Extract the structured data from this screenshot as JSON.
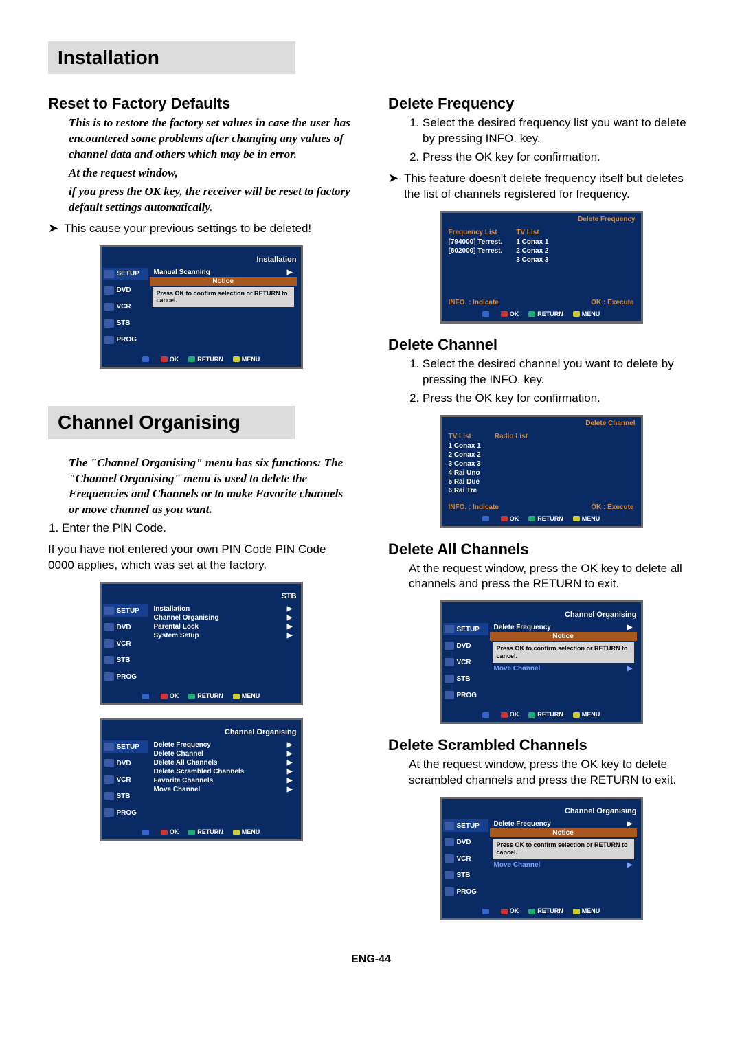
{
  "sections": {
    "installation": "Installation",
    "channel_org": "Channel Organising"
  },
  "left": {
    "reset_head": "Reset to Factory Defaults",
    "reset_italic_1": "This is to restore the factory set values in case the user has encountered some problems  after changing any values of channel data and others which may be in error.",
    "reset_italic_2": "At the request window,",
    "reset_italic_3": "if you press the OK key, the receiver will be reset to factory default settings automatically.",
    "reset_note": "This cause your previous settings to be deleted!",
    "chorg_italic": "The \"Channel Organising\" menu has six functions: The \"Channel Organising\" menu is used to delete the Frequencies and Channels or to make Favorite channels or move channel as you want.",
    "pin_step": "Enter the PIN Code.",
    "pin_note": "If you have not entered your own PIN Code PIN Code 0000 applies, which was set at the factory."
  },
  "right": {
    "delfreq_head": "Delete Frequency",
    "delfreq_s1": "Select the desired frequency list you want to delete by pressing INFO. key.",
    "delfreq_s2": "Press the OK key for confirmation.",
    "delfreq_note": "This feature doesn't delete frequency itself but deletes the list of channels registered for frequency.",
    "delch_head": "Delete Channel",
    "delch_s1": "Select the desired channel you want to delete by pressing the INFO. key.",
    "delch_s2": "Press the OK key for confirmation.",
    "delall_head": "Delete All Channels",
    "delall_text": "At the request window, press the OK key to delete all channels and press the RETURN to exit.",
    "delscr_head": "Delete Scrambled Channels",
    "delscr_text": "At the request window, press the OK key to delete scrambled channels and press the RETURN to exit."
  },
  "foot": "ENG-44",
  "side_labels": {
    "setup": "SETUP",
    "dvd": "DVD",
    "vcr": "VCR",
    "stb": "STB",
    "prog": "PROG"
  },
  "osd_foot": {
    "ok": "OK",
    "return": "RETURN",
    "menu": "MENU"
  },
  "shot_install": {
    "title": "Installation",
    "line1": "Manual Scanning",
    "notice": "Notice",
    "notice_body": "Press OK to confirm selection or RETURN to cancel."
  },
  "shot_stb": {
    "title": "STB",
    "l1": "Installation",
    "l2": "Channel Organising",
    "l3": "Parental Lock",
    "l4": "System Setup"
  },
  "shot_chorg": {
    "title": "Channel Organising",
    "l1": "Delete Frequency",
    "l2": "Delete Channel",
    "l3": "Delete All Channels",
    "l4": "Delete Scrambled Channels",
    "l5": "Favorite Channels",
    "l6": "Move Channel"
  },
  "shot_delfreq": {
    "title": "Delete Frequency",
    "left_head": "Frequency List",
    "left_1": "[794000] Terrest.",
    "left_2": "[802000] Terrest.",
    "right_head": "TV List",
    "right_1": "1 Conax 1",
    "right_2": "2 Conax 2",
    "right_3": "3 Conax 3",
    "b1": "INFO. : Indicate",
    "b2": "OK : Execute"
  },
  "shot_delch": {
    "title": "Delete Channel",
    "left_head": "TV List",
    "l1": "1 Conax 1",
    "l2": "2 Conax 2",
    "l3": "3 Conax 3",
    "l4": "4 Rai Uno",
    "l5": "5 Rai Due",
    "l6": "6 Rai Tre",
    "right_head": "Radio List",
    "b1": "INFO. : Indicate",
    "b2": "OK : Execute"
  },
  "shot_notice_generic": {
    "title": "Channel Organising",
    "l1": "Delete Frequency",
    "notice": "Notice",
    "notice_body": "Press OK to confirm selection or RETURN to cancel.",
    "l_after": "Move Channel"
  }
}
